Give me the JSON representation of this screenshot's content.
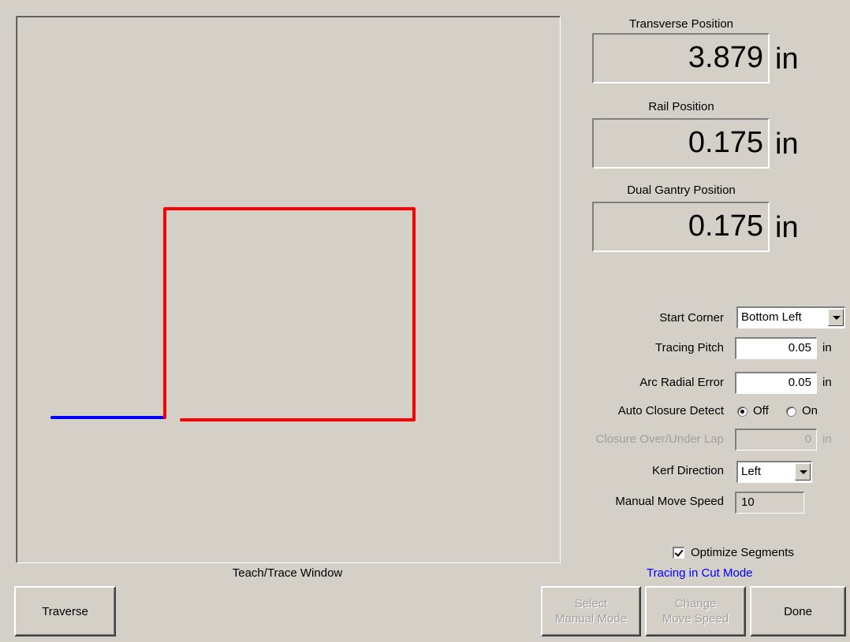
{
  "trace_window": {
    "caption": "Teach/Trace Window",
    "traverse_color": "#0000ff",
    "cut_color": "#ff0000"
  },
  "readouts": {
    "transverse": {
      "label": "Transverse Position",
      "value": "3.879",
      "unit": "in"
    },
    "rail": {
      "label": "Rail Position",
      "value": "0.175",
      "unit": "in"
    },
    "dual_gantry": {
      "label": "Dual Gantry Position",
      "value": "0.175",
      "unit": "in"
    }
  },
  "settings": {
    "start_corner": {
      "label": "Start Corner",
      "value": "Bottom Left"
    },
    "tracing_pitch": {
      "label": "Tracing Pitch",
      "value": "0.05",
      "unit": "in"
    },
    "arc_radial_error": {
      "label": "Arc Radial Error",
      "value": "0.05",
      "unit": "in"
    },
    "auto_closure": {
      "label": "Auto Closure Detect",
      "off_label": "Off",
      "on_label": "On",
      "selected": "Off"
    },
    "closure_lap": {
      "label": "Closure Over/Under Lap",
      "value": "0",
      "unit": "in"
    },
    "kerf_direction": {
      "label": "Kerf Direction",
      "value": "Left"
    },
    "manual_move_speed": {
      "label": "Manual Move Speed",
      "value": "10"
    },
    "optimize_segments": {
      "label": "Optimize Segments",
      "checked": true
    }
  },
  "status": {
    "text": "Tracing in Cut Mode",
    "color": "#0000ff"
  },
  "buttons": {
    "traverse": "Traverse",
    "select_manual_mode": "Select\nManual Mode",
    "change_move_speed": "Change\nMove Speed",
    "done": "Done"
  }
}
